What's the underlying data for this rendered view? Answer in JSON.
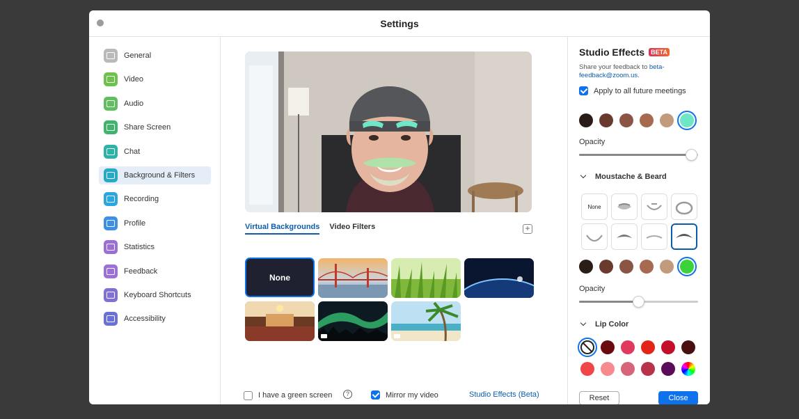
{
  "window": {
    "title": "Settings"
  },
  "sidebar": {
    "items": [
      {
        "label": "General",
        "icon": "gear-icon",
        "color": "#b9b9b9"
      },
      {
        "label": "Video",
        "icon": "video-icon",
        "color": "#6cc24a"
      },
      {
        "label": "Audio",
        "icon": "headphones-icon",
        "color": "#5fbf5f"
      },
      {
        "label": "Share Screen",
        "icon": "share-screen-icon",
        "color": "#3fb56b"
      },
      {
        "label": "Chat",
        "icon": "chat-icon",
        "color": "#2ab3a6"
      },
      {
        "label": "Background & Filters",
        "icon": "background-icon",
        "color": "#25a9c9"
      },
      {
        "label": "Recording",
        "icon": "recording-icon",
        "color": "#2aa6e0"
      },
      {
        "label": "Profile",
        "icon": "profile-icon",
        "color": "#3b8fe6"
      },
      {
        "label": "Statistics",
        "icon": "statistics-icon",
        "color": "#9b6fd6"
      },
      {
        "label": "Feedback",
        "icon": "feedback-icon",
        "color": "#9d6fd9"
      },
      {
        "label": "Keyboard Shortcuts",
        "icon": "keyboard-icon",
        "color": "#7f6fd6"
      },
      {
        "label": "Accessibility",
        "icon": "accessibility-icon",
        "color": "#6b6fd8"
      }
    ],
    "active_index": 5
  },
  "main": {
    "tabs": [
      {
        "label": "Virtual Backgrounds",
        "active": true
      },
      {
        "label": "Video Filters",
        "active": false
      }
    ],
    "backgrounds": [
      {
        "label": "None",
        "selected": true,
        "video": false
      },
      {
        "label": "",
        "selected": false,
        "video": false
      },
      {
        "label": "",
        "selected": false,
        "video": false
      },
      {
        "label": "",
        "selected": false,
        "video": false
      },
      {
        "label": "",
        "selected": false,
        "video": false
      },
      {
        "label": "",
        "selected": false,
        "video": true
      },
      {
        "label": "",
        "selected": false,
        "video": true
      }
    ],
    "green_screen": {
      "label": "I have a green screen",
      "checked": false
    },
    "mirror": {
      "label": "Mirror my video",
      "checked": true
    },
    "studio_link": "Studio Effects (Beta)"
  },
  "panel": {
    "title": "Studio Effects",
    "badge": "BETA",
    "feedback_prefix": "Share your feedback to ",
    "feedback_email": "beta-feedback@zoom.us",
    "feedback_suffix": ".",
    "apply_label": "Apply to all future meetings",
    "apply_checked": true,
    "eyebrow_colors": [
      "#2a1d17",
      "#6b3a2e",
      "#8c5444",
      "#a86a4f",
      "#c29a7c",
      "#6ee6c8"
    ],
    "eyebrow_selected": 5,
    "opacity_label": "Opacity",
    "opacity1_value": 0.95,
    "moustache_heading": "Moustache & Beard",
    "moustache_none": "None",
    "moustache_selected": 7,
    "moustache_colors": [
      "#2a1d17",
      "#6b3a2e",
      "#8c5444",
      "#a86a4f",
      "#c29a7c",
      "#3ad43a"
    ],
    "moustache_color_selected": 5,
    "opacity2_value": 0.5,
    "lip_heading": "Lip Color",
    "lip_colors": [
      "none",
      "#6b0a0e",
      "#e03a5e",
      "#e3241b",
      "#c2102a",
      "#4a0d10",
      "#f0464a",
      "#f58a8f",
      "#d6647a",
      "#b83349",
      "#5a0c5a",
      "rainbow"
    ],
    "lip_selected": 0,
    "reset_label": "Reset",
    "close_label": "Close"
  }
}
